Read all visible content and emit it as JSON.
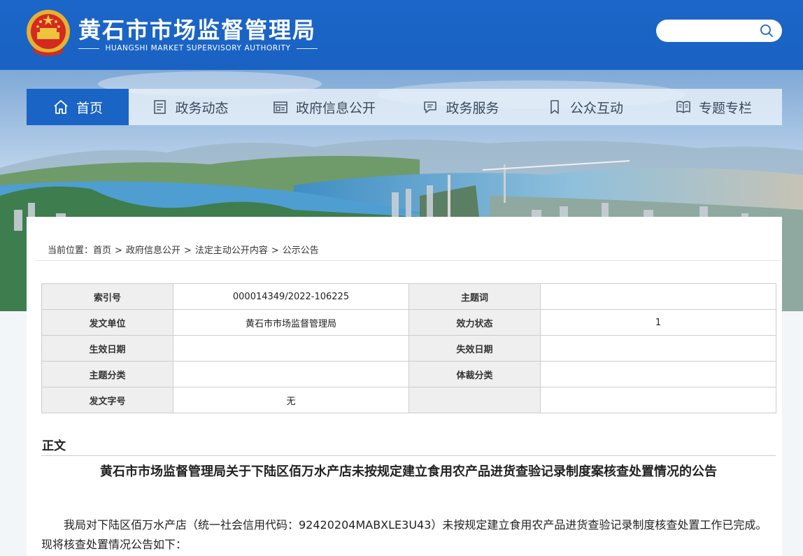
{
  "header": {
    "title": "黄石市市场监督管理局",
    "subtitle": "HUANGSHI MARKET SUPERVISORY AUTHORITY",
    "search_placeholder": "",
    "search_icon": "search-icon"
  },
  "nav": {
    "items": [
      {
        "label": "首页",
        "icon": "home-icon",
        "active": true
      },
      {
        "label": "政务动态",
        "icon": "news-icon",
        "active": false
      },
      {
        "label": "政府信息公开",
        "icon": "info-icon",
        "active": false
      },
      {
        "label": "政务服务",
        "icon": "service-icon",
        "active": false
      },
      {
        "label": "公众互动",
        "icon": "bookmark-icon",
        "active": false
      },
      {
        "label": "专题专栏",
        "icon": "book-icon",
        "active": false
      }
    ]
  },
  "breadcrumb": {
    "prefix": "当前位置：",
    "items": [
      "首页",
      "政府信息公开",
      "法定主动公开内容",
      "公示公告"
    ],
    "separator": ">"
  },
  "meta_table": {
    "rows": [
      {
        "l1": "索引号",
        "v1": "000014349/2022-106225",
        "l2": "主题词",
        "v2": ""
      },
      {
        "l1": "发文单位",
        "v1": "黄石市市场监督管理局",
        "l2": "效力状态",
        "v2": "1"
      },
      {
        "l1": "生效日期",
        "v1": "",
        "l2": "失效日期",
        "v2": ""
      },
      {
        "l1": "主题分类",
        "v1": "",
        "l2": "体裁分类",
        "v2": ""
      },
      {
        "l1": "发文字号",
        "v1": "无",
        "l2": "",
        "v2": ""
      }
    ]
  },
  "content": {
    "section_label": "正文",
    "title": "黄石市市场监督管理局关于下陆区佰万水产店未按规定建立食用农产品进货查验记录制度案核查处置情况的公告",
    "paragraph": "我局对下陆区佰万水产店（统一社会信用代码：92420204MABXLE3U43）未按规定建立食用农产品进货查验记录制度核查处置工作已完成。现将核查处置情况公告如下："
  },
  "colors": {
    "header_blue": "#1b66c9",
    "nav_active": "#1a64c6"
  }
}
